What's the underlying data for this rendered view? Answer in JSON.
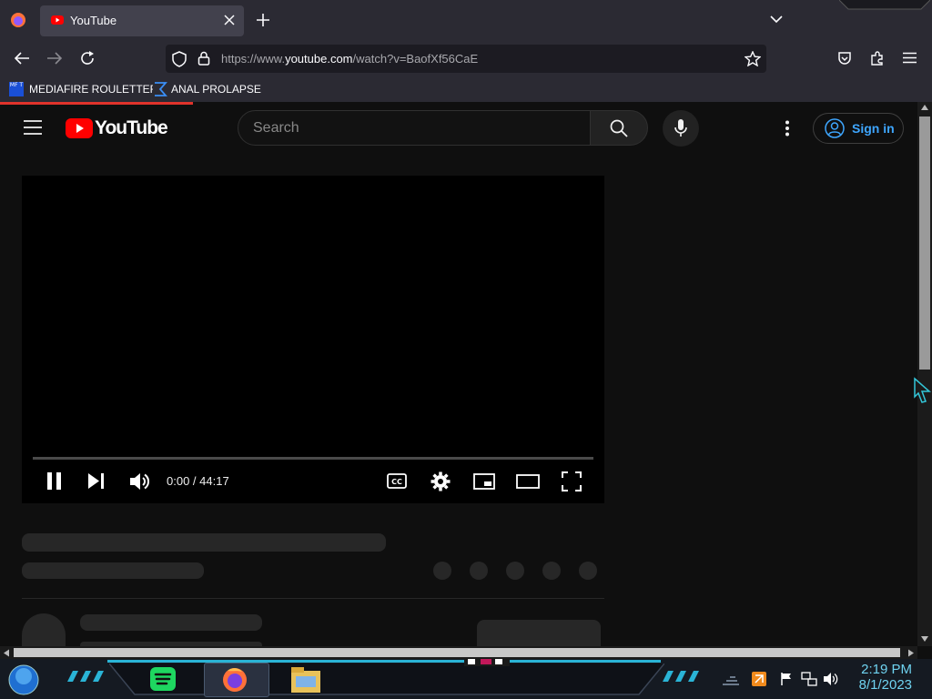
{
  "browser": {
    "tab_title": "YouTube",
    "url_prefix": "https://www.",
    "url_domain": "youtube.com",
    "url_path": "/watch?v=BaofXf56CaE",
    "bookmarks": [
      {
        "label": "MEDIAFIRE ROULETTER",
        "icon": "mediafire-icon",
        "icon_text": "MF T"
      },
      {
        "label": "ANAL PROLAPSE",
        "icon": "sigma-icon"
      }
    ]
  },
  "youtube": {
    "logo_text": "YouTube",
    "search_placeholder": "Search",
    "signin_label": "Sign in",
    "accent": "#ff0000",
    "signin_color": "#3ea6ff"
  },
  "player": {
    "current_time": "0:00",
    "separator": " / ",
    "duration": "44:17",
    "progress": 0
  },
  "taskbar": {
    "time": "2:19 PM",
    "date": "8/1/2023"
  }
}
